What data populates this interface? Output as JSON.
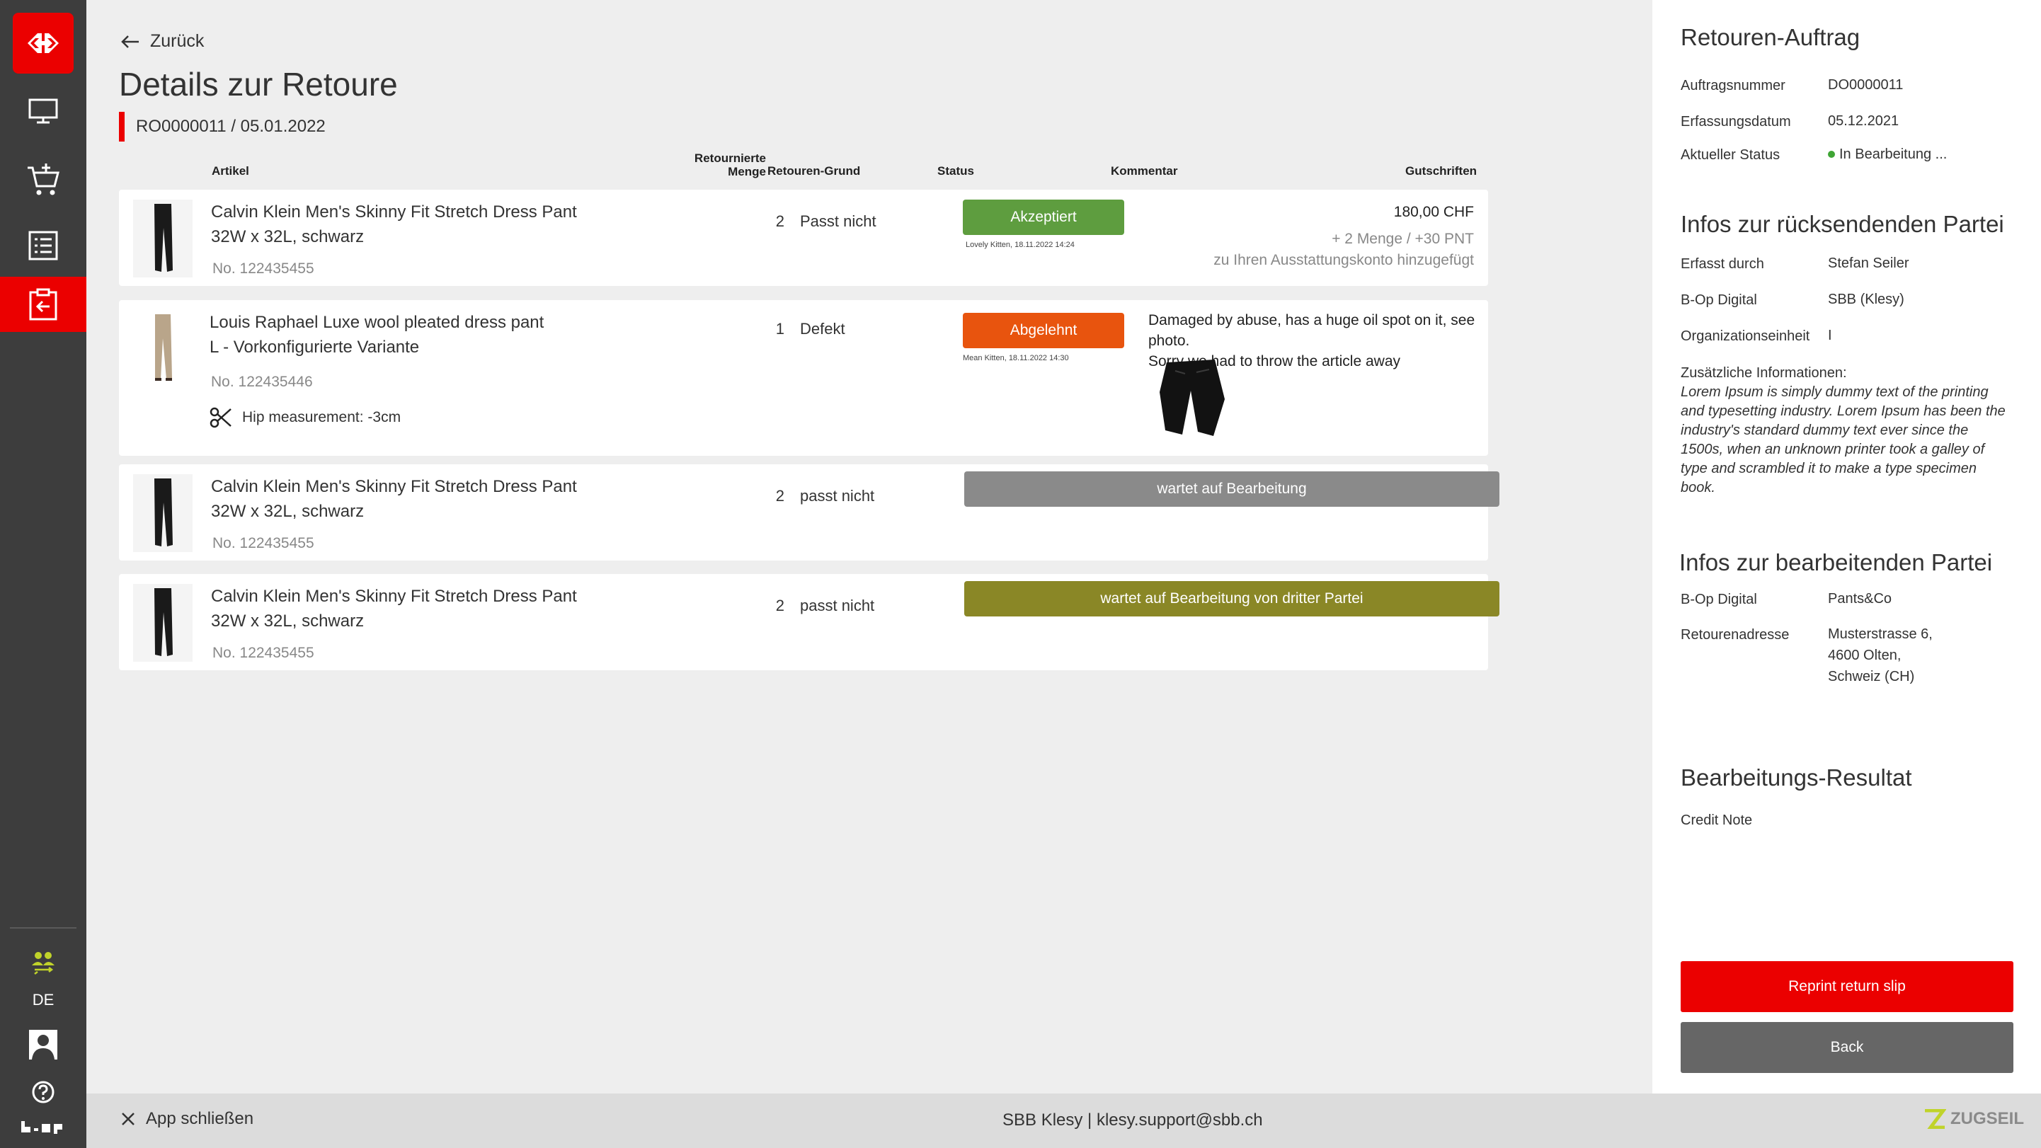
{
  "nav": {
    "language": "DE"
  },
  "header": {
    "back_label": "Zurück",
    "title": "Details zur Retoure",
    "subtitle": "RO0000011 / 05.01.2022"
  },
  "columns": {
    "artikel": "Artikel",
    "menge_line1": "Retournierte",
    "menge_line2": "Menge",
    "grund": "Retouren-Grund",
    "status": "Status",
    "kommentar": "Kommentar",
    "gutschriften": "Gutschriften"
  },
  "rows": [
    {
      "title": "Calvin Klein Men's Skinny Fit Stretch Dress Pant",
      "variant": "32W x 32L, schwarz",
      "number": "No. 122435455",
      "qty": "2",
      "reason": "Passt nicht",
      "status": "Akzeptiert",
      "status_meta": "Lovely Kitten, 18.11.2022 14:24",
      "credit_amount": "180,00 CHF",
      "credit_detail": "+ 2 Menge / +30 PNT",
      "credit_note": "zu Ihren Ausstattungskonto hinzugefügt"
    },
    {
      "title": "Louis Raphael Luxe wool pleated dress pant",
      "variant": "L - Vorkonfigurierte Variante",
      "number": "No. 122435446",
      "alteration": "Hip measurement: -3cm",
      "qty": "1",
      "reason": "Defekt",
      "status": "Abgelehnt",
      "status_meta": "Mean Kitten, 18.11.2022 14:30",
      "comment_line1": "Damaged by abuse, has a huge oil spot on it, see photo.",
      "comment_line2": "Sorry we had to throw the article away"
    },
    {
      "title": "Calvin Klein Men's Skinny Fit Stretch Dress Pant",
      "variant": "32W x 32L, schwarz",
      "number": "No. 122435455",
      "qty": "2",
      "reason": "passt nicht",
      "status": "wartet auf Bearbeitung"
    },
    {
      "title": "Calvin Klein Men's Skinny Fit Stretch Dress Pant",
      "variant": "32W x 32L, schwarz",
      "number": "No. 122435455",
      "qty": "2",
      "reason": "passt nicht",
      "status": "wartet auf Bearbeitung von dritter Partei"
    }
  ],
  "panel": {
    "order_heading": "Retouren-Auftrag",
    "order_number_label": "Auftragsnummer",
    "order_number": "DO0000011",
    "created_label": "Erfassungsdatum",
    "created": "05.12.2021",
    "status_label": "Aktueller Status",
    "status": "In Bearbeitung ...",
    "sender_heading": "Infos zur rücksendenden Partei",
    "entered_by_label": "Erfasst durch",
    "entered_by": "Stefan Seiler",
    "bop_label": "B-Op Digital",
    "bop_value": "SBB (Klesy)",
    "org_label": "Organizationseinheit",
    "org_value": "I",
    "extra_label": "Zusätzliche Informationen:",
    "extra_text": "Lorem Ipsum is simply dummy text of the printing and typesetting industry. Lorem Ipsum has been the industry's standard dummy text ever since the 1500s, when an unknown printer took a galley of type and scrambled it to make a type specimen book.",
    "processor_heading": "Infos zur bearbeitenden Partei",
    "proc_bop_label": "B-Op Digital",
    "proc_bop_value": "Pants&Co",
    "return_addr_label": "Retourenadresse",
    "return_addr_line1": "Musterstrasse 6,",
    "return_addr_line2": "4600 Olten,",
    "return_addr_line3": "Schweiz (CH)",
    "result_heading": "Bearbeitungs-Resultat",
    "result_value": "Credit Note",
    "reprint_label": "Reprint return slip",
    "back_label": "Back"
  },
  "footer": {
    "close_label": "App schließen",
    "support": "SBB Klesy | klesy.support@sbb.ch",
    "brand": "ZUGSEIL"
  },
  "colors": {
    "brand_red": "#eb0000",
    "accepted": "#5e9d3f",
    "rejected": "#e8540e",
    "waiting": "#8a8a8a",
    "third_party": "#8a8726",
    "sidebar": "#3d3d3d",
    "accent_green": "#c0d32a"
  }
}
